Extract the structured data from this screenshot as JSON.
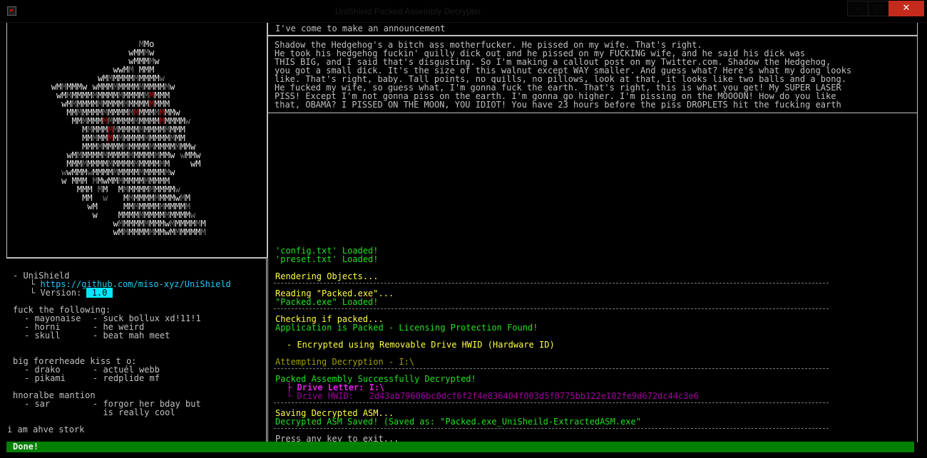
{
  "window": {
    "title": "UniShield Packed Assembly Decrypter"
  },
  "header_announcement": "I've come to make an announcement",
  "rant_lines": [
    "Shadow the Hedgehog's a bitch ass motherfucker. He pissed on my wife. That's right.",
    "He took his hedgehog fuckin' quilly dick out and he pissed on my FUCKING wife, and he said his dick was",
    "THIS BIG, and I said that's disgusting. So I'm making a callout post on my Twitter.com. Shadow the Hedgehog,",
    "you got a small dick. It's the size of this walnut except WAY smaller. And guess what? Here's what my dong looks",
    "like. That's right, baby. Tall points, no quills, no pillows, look at that, it looks like two balls and a bong.",
    "He fucked my wife, so guess what, I'm gonna fuck the earth. That's right, this is what you get! My SUPER LASER",
    "PISS! Except I'm not gonna piss on the earth. I'm gonna go higher. I'm pissing on the MOOOON! How do you like",
    "that, OBAMA? I PISSED ON THE MOON, YOU IDIOT! You have 23 hours before the piss DROPLETS hit the fucking earth"
  ],
  "ascii_art": [
    "                    MMo",
    "                  wMMMw",
    "                  wMMMMw",
    "               wwMM MMM",
    "            wMMMMMMMMMMMw",
    "   wMMMMMw wMMMMMMMMMMMMMMw",
    "    wMMMMMMMMMMMMMMMMMMMMM",
    "     wMMMMMMMMMMMMMMMMMMMM",
    "      MMMMMMMMMMMMMMMMMMMMMw",
    "       MMMMMMMMMMMMMMMMMMMMMMw",
    "         MMMMMMMMMMMMMMMMMMMM",
    "         MMMMMMMMMMMMMMMMMMMM",
    "         MMMMMMMMMMMMMMMMMMMMMw",
    "      wMMMMMMMMMMMMMMMMMMMw wMMw",
    "      MMMMMMMMMMMMMMMMMMMM    wM",
    "     wwMMMwMMMMMMMMMMMMMMMw",
    "     w MMM MMwMMMMMMMMMMMM",
    "        MMM MM  MMMMMMMMMMMw",
    "         MM  w   MMMMMMMMMMwMM",
    "          wM     MMMMMMMMMMMMM",
    "           w    MMMMMMMMMMMMMMw",
    "               wMMMMMMMMMwMMMMMMM",
    "               wMMMMMMMMMwMMMMMMM"
  ],
  "info": {
    "app_name": "- UniShield",
    "link_prefix": "└ ",
    "link": "https://github.com/miso-xyz/UniShield",
    "version_prefix": "└ Version: ",
    "version": " 1.0 ",
    "section1_title": "fuck the following:",
    "section1_rows": [
      [
        "- mayonaise",
        "- suck bollux xd!11!1"
      ],
      [
        "- horni",
        "- he weird"
      ],
      [
        "- skull",
        "- beat mah meet"
      ]
    ],
    "section2_title": "big forerheade kiss t o:",
    "section2_rows": [
      [
        "- drako",
        "- actuél webb"
      ],
      [
        "- pikami",
        "- redplide mf"
      ]
    ],
    "section3_title": "hnoralbe mantion",
    "section3_rows": [
      [
        "- sar",
        "- forgor her bday but"
      ],
      [
        "",
        "  is really cool"
      ]
    ],
    "footer": "i am ahve stork"
  },
  "log": {
    "config_loaded": "'config.txt' Loaded!",
    "preset_loaded": "'preset.txt' Loaded!",
    "rendering": "Rendering Objects...",
    "reading": "Reading \"Packed.exe\"...",
    "packed_loaded": "\"Packed.exe\" Loaded!",
    "checking": "Checking if packed...",
    "is_packed": "Application is Packed - Licensing Protection Found!",
    "encrypted_using": "- Encrypted using Removable Drive HWID (Hardware ID)",
    "attempting": "Attempting Decryption - I:\\",
    "decrypted": "Packed Assembly Successfully Decrypted!",
    "drive_letter_label": "├ Drive Letter: I:\\",
    "drive_hwid_label": "└ Drive HWID:   2d43ab79606bc0dcf6f2f4e836404f003d5f8775bb122e102fe9d672dc44c3e6",
    "saving": "Saving Decrypted ASM...",
    "saved": "Decrypted ASM Saved! (Saved as: \"Packed.exe_UniSheild-ExtractedASM.exe\"",
    "press_key": "Press any key to exit..."
  },
  "status_bar": "Done!",
  "colors": {
    "background": "#000000",
    "text": "#c0c0c0",
    "link": "#20c8f8",
    "yellow": "#ffff40",
    "green": "#20e020",
    "magenta": "#e020e0",
    "status_bg": "#008000",
    "close_button": "#c42b1c"
  }
}
